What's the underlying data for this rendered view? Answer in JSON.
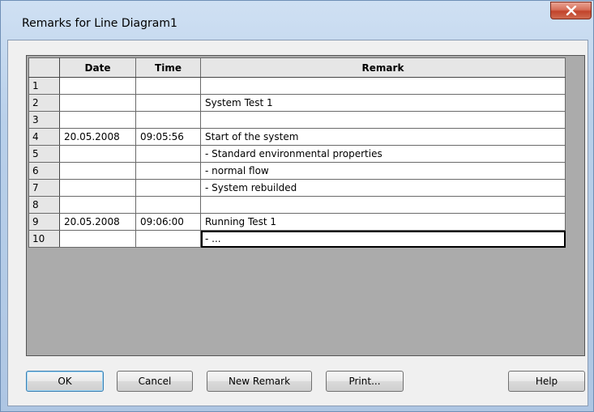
{
  "window": {
    "title": "Remarks for Line Diagram1"
  },
  "grid": {
    "headers": {
      "date": "Date",
      "time": "Time",
      "remark": "Remark"
    },
    "rows": [
      {
        "num": "1",
        "date": "",
        "time": "",
        "remark": ""
      },
      {
        "num": "2",
        "date": "",
        "time": "",
        "remark": "System Test 1"
      },
      {
        "num": "3",
        "date": "",
        "time": "",
        "remark": ""
      },
      {
        "num": "4",
        "date": "20.05.2008",
        "time": "09:05:56",
        "remark": "Start of the system"
      },
      {
        "num": "5",
        "date": "",
        "time": "",
        "remark": "- Standard environmental properties"
      },
      {
        "num": "6",
        "date": "",
        "time": "",
        "remark": "- normal flow"
      },
      {
        "num": "7",
        "date": "",
        "time": "",
        "remark": "- System rebuilded"
      },
      {
        "num": "8",
        "date": "",
        "time": "",
        "remark": ""
      },
      {
        "num": "9",
        "date": "20.05.2008",
        "time": "09:06:00",
        "remark": "Running Test 1"
      },
      {
        "num": "10",
        "date": "",
        "time": "",
        "remark": "- ..."
      }
    ]
  },
  "buttons": {
    "ok": "OK",
    "cancel": "Cancel",
    "new_remark": "New Remark",
    "print": "Print...",
    "help": "Help"
  },
  "colors": {
    "title_bar": "#b9d0ea",
    "close_button": "#c1432b",
    "client_bg": "#f0f0f0",
    "grid_bg": "#ababab",
    "default_button_border": "#3c7fb1"
  },
  "icons": {
    "close": "close-icon"
  }
}
